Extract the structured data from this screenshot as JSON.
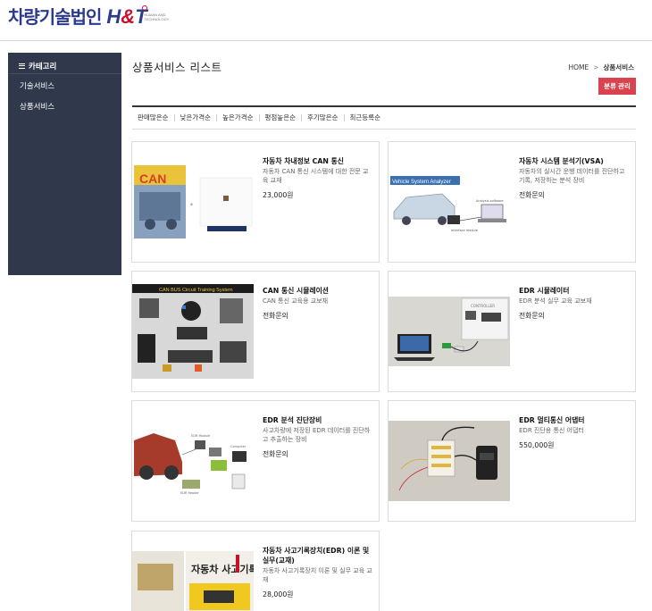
{
  "header": {
    "logo_kr": "차량기술법인",
    "logo_h": "H",
    "logo_amp": "&",
    "logo_t": "T",
    "logo_tagline": "HUMAN AND TECHNOLOGY"
  },
  "sidebar": {
    "title": "카테고리",
    "items": [
      {
        "label": "기술서비스"
      },
      {
        "label": "상품서비스"
      }
    ]
  },
  "main": {
    "title": "상품서비스 리스트",
    "breadcrumb": {
      "home": "HOME",
      "separator": ">",
      "current": "상품서비스"
    },
    "admin_button": "분류 관리",
    "sort_options": [
      "판매많은순",
      "낮은가격순",
      "높은가격순",
      "평점높은순",
      "후기많은순",
      "최근등록순"
    ]
  },
  "products": [
    {
      "title": "자동차 차내정보 CAN 통신",
      "desc": "자동차 CAN 통신 시스템에 대한 전문 교육 교재",
      "price": "23,000원",
      "image": "can-book-image"
    },
    {
      "title": "자동차 시스템 분석기(VSA)",
      "desc": "자동차의 실시간 운행 데이터를 진단하고 기록, 저장하는 분석 장비",
      "price": "전화문의",
      "image": "vsa-image",
      "image_caption": "Vehicle System Analyzer"
    },
    {
      "title": "CAN 통신 시뮬레이션",
      "desc": "CAN 통신 교육용 교보재",
      "price": "전화문의",
      "image": "can-simulator-image",
      "image_caption": "CAN BUS Circuit Training System"
    },
    {
      "title": "EDR 시뮬레이터",
      "desc": "EDR 분석 실무 교육 교보재",
      "price": "전화문의",
      "image": "edr-simulator-image"
    },
    {
      "title": "EDR 분석 진단장비",
      "desc": "사고차량에 저장된 EDR 데이터를 진단하고 추출하는 장비",
      "price": "전화문의",
      "image": "edr-diagnostic-image"
    },
    {
      "title": "EDR 멀티통신 어댑터",
      "desc": "EDR 진단용 통신 어댑터",
      "price": "550,000원",
      "image": "edr-adapter-image"
    },
    {
      "title": "자동차 사고기록장치(EDR) 이론 및 실무(교재)",
      "desc": "자동차 사고기록장치 이론 및 실무 교육 교재",
      "price": "28,000원",
      "image": "edr-book-image",
      "image_caption": "자동차 사고기록장치"
    }
  ],
  "colors": {
    "brand_blue": "#2b3a8c",
    "brand_red": "#c8102e",
    "sidebar_bg": "#30384b",
    "admin_button_bg": "#d9434d"
  }
}
